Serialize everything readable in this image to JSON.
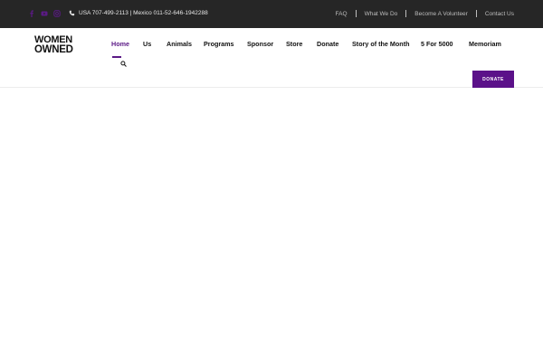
{
  "topbar": {
    "social_icons": [
      "facebook-icon",
      "youtube-icon",
      "instagram-icon"
    ],
    "phone_text": "USA 707-499-2113 | Mexico 011-52-646-1942288",
    "links": [
      "FAQ",
      "What We Do",
      "Become A Volunteer",
      "Contact Us"
    ]
  },
  "logo": {
    "line1": "WOMEN",
    "line2": "OWNED"
  },
  "nav": {
    "items": [
      "Home",
      "Us",
      "Animals",
      "Programs",
      "Sponsor",
      "Store",
      "Donate",
      "Story of the Month",
      "5 For 5000",
      "Memoriam"
    ],
    "active": "Home"
  },
  "donate_button": "DONATE",
  "colors": {
    "topbar_bg": "#262626",
    "accent": "#5b1189",
    "social_icon": "#5b1a86"
  }
}
